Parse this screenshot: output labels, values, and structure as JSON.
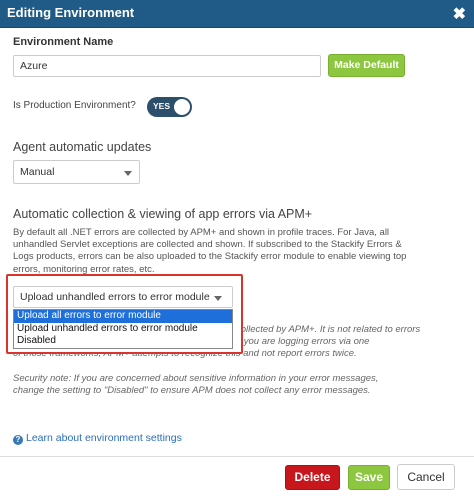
{
  "dialog": {
    "title": "Editing Environment",
    "close_glyph": "✖"
  },
  "environment_name": {
    "label": "Environment Name",
    "value": "Azure",
    "make_default_label": "Make Default"
  },
  "production": {
    "label": "Is Production Environment?",
    "toggle_text": "YES",
    "on": true
  },
  "agent_updates": {
    "title": "Agent automatic updates",
    "selected": "Manual"
  },
  "errors": {
    "title": "Automatic collection & viewing of app errors via APM+",
    "description_lines": [
      "By default all .NET errors are collected by APM+ and shown in profile traces. For Java, all",
      "unhandled Servlet exceptions are collected and shown. If subscribed to the Stackify Errors &",
      "Logs products, errors can be also uploaded to the Stackify error module to enable viewing top",
      "errors, monitoring error rates, etc."
    ],
    "select_value": "Upload unhandled errors to error module",
    "options": [
      "Upload all errors to error module",
      "Upload unhandled errors to error module",
      "Disabled"
    ],
    "note_lines": [
      "collected by APM+. It is not related to errors",
      "using the logging frameworks like log4net, log4j, etc. If you are logging errors via one",
      "of those frameworks, APM+ attempts to recognize this and not report errors twice."
    ],
    "security_lines": [
      "Security note: If you are concerned about sensitive information in your error messages,",
      "change the setting to \"Disabled\" to ensure APM does not collect any error messages."
    ]
  },
  "help": {
    "link_text": "Learn about environment settings"
  },
  "footer": {
    "delete_label": "Delete",
    "save_label": "Save",
    "cancel_label": "Cancel"
  },
  "colors": {
    "titlebar": "#1f5b86",
    "green": "#8dc63f",
    "delete_red": "#c8161d",
    "highlight": "#d9352e",
    "selected_option": "#1e6fd9"
  }
}
